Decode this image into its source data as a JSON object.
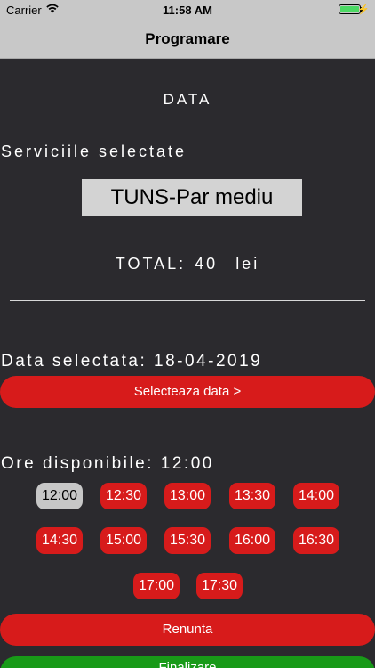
{
  "status_bar": {
    "carrier": "Carrier",
    "time": "11:58 AM",
    "battery_level": 1.0
  },
  "nav": {
    "title": "Programare"
  },
  "main": {
    "data_label": "DATA",
    "services_label": "Serviciile selectate",
    "service_selected": "TUNS-Par mediu",
    "total_label": "TOTAL:",
    "total_value": "40",
    "total_currency": "lei",
    "selected_date_label": "Data selectata: 18-04-2019",
    "select_date_button": "Selecteaza data   >",
    "available_label": "Ore disponibile: 12:00",
    "time_slots": [
      "12:00",
      "12:30",
      "13:00",
      "13:30",
      "14:00",
      "14:30",
      "15:00",
      "15:30",
      "16:00",
      "16:30",
      "17:00",
      "17:30"
    ],
    "selected_slot": "12:00",
    "cancel_button": "Renunta",
    "finish_button": "Finalizare"
  },
  "colors": {
    "background": "#2b2a2e",
    "bar": "#c8c8c8",
    "accent_red": "#d71b1b",
    "selected_slot": "#c7c7c7",
    "finish_green": "#189a18"
  }
}
